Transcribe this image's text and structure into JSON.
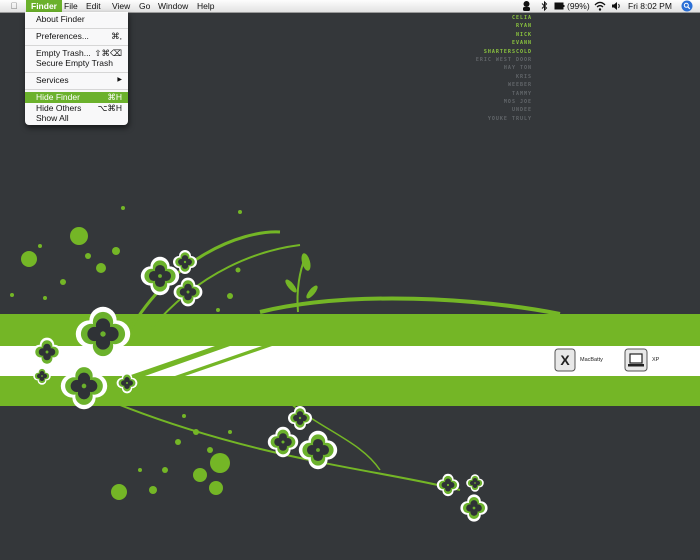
{
  "menubar": {
    "apple": "",
    "items": [
      "Finder",
      "File",
      "Edit",
      "View",
      "Go",
      "Window",
      "Help"
    ],
    "battery": "(99%)",
    "clock": "Fri 8:02 PM"
  },
  "finder_menu": {
    "items": [
      {
        "label": "About Finder",
        "shortcut": ""
      },
      {
        "label": "Preferences...",
        "shortcut": "⌘,"
      },
      {
        "label": "Empty Trash...",
        "shortcut": "⇧⌘⌫"
      },
      {
        "label": "Secure Empty Trash",
        "shortcut": ""
      },
      {
        "label": "Services",
        "shortcut": "▶"
      },
      {
        "label": "Hide Finder",
        "shortcut": "⌘H"
      },
      {
        "label": "Hide Others",
        "shortcut": "⌥⌘H"
      },
      {
        "label": "Show All",
        "shortcut": ""
      }
    ]
  },
  "desktop": {
    "names": [
      "CELIA",
      "RYAN",
      "NICK",
      "EVANN",
      "SHARTERSCOLD",
      "ERIC WEST DOOR",
      "HAY TON",
      "KRIS",
      "WEEBER",
      "TAMMY",
      "MOS JOE",
      "UNDEE",
      "YOUKE TRULY"
    ],
    "icons": [
      {
        "label": "MacBatty"
      },
      {
        "label": "XP"
      }
    ]
  },
  "colors": {
    "background": "#34373a",
    "accent": "#6bb12c",
    "flower_dark": "#2f3236"
  }
}
